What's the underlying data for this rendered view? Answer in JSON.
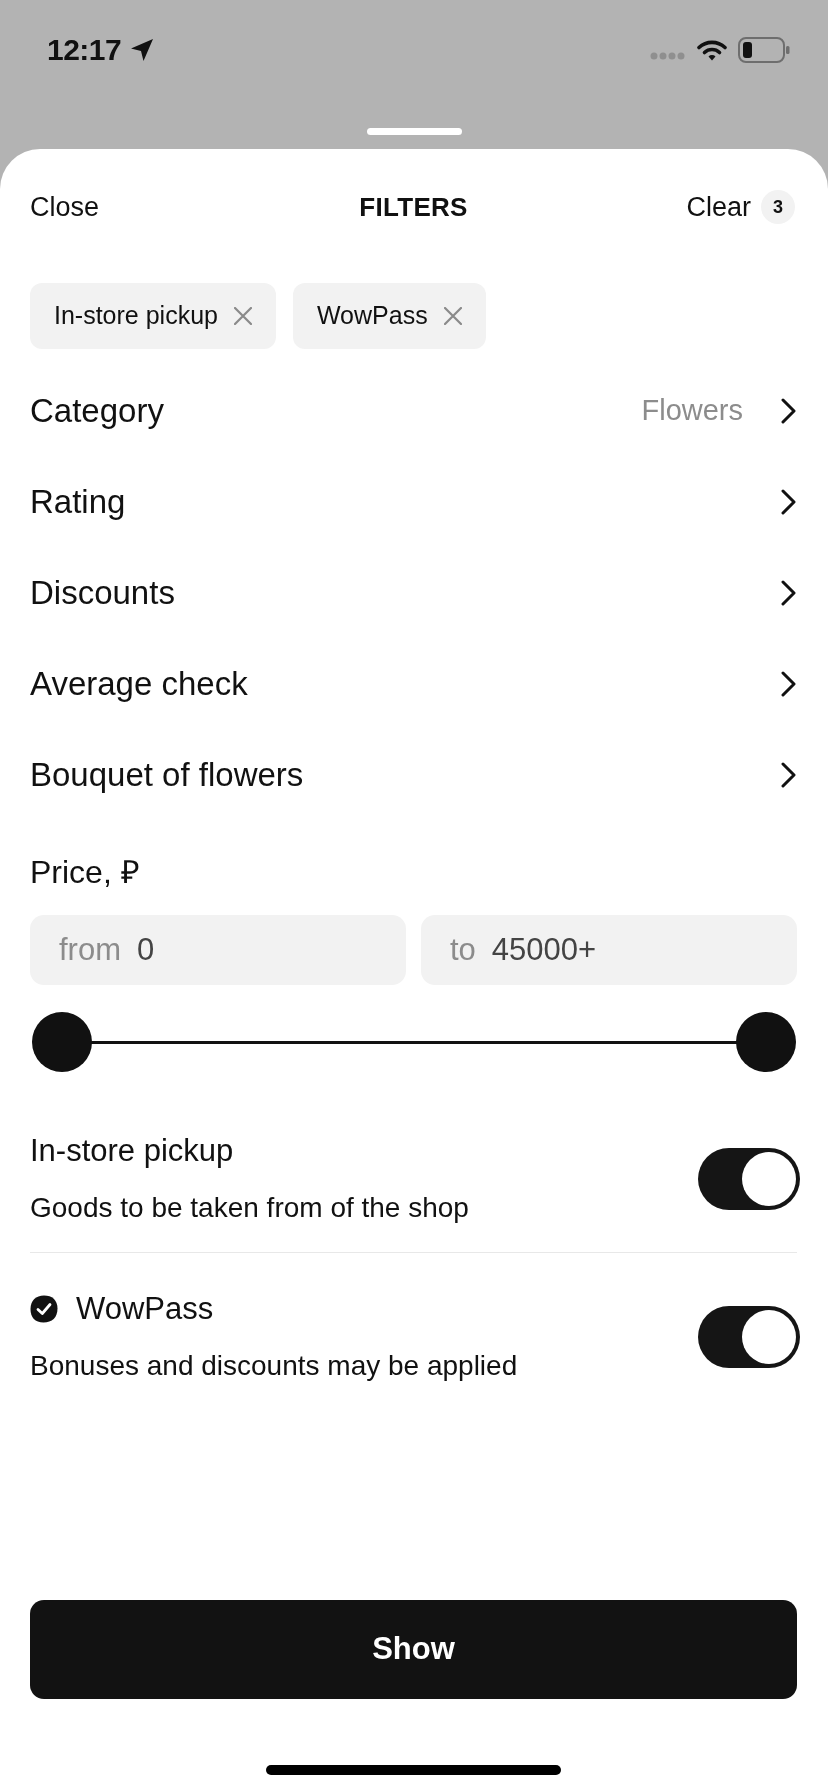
{
  "status_bar": {
    "time": "12:17"
  },
  "sheet": {
    "header": {
      "close": "Close",
      "title": "FILTERS",
      "clear": "Clear",
      "clear_count": "3"
    },
    "chips": [
      {
        "label": "In-store pickup"
      },
      {
        "label": "WowPass"
      }
    ],
    "options": [
      {
        "label": "Category",
        "value": "Flowers"
      },
      {
        "label": "Rating"
      },
      {
        "label": "Discounts"
      },
      {
        "label": "Average check"
      },
      {
        "label": "Bouquet of flowers"
      }
    ],
    "price": {
      "label": "Price, ₽",
      "fields": [
        {
          "prefix": "from",
          "value": "0"
        },
        {
          "prefix": "to",
          "value": "45000+"
        }
      ],
      "slider": {
        "thumbs": [
          {
            "level": 0
          },
          {
            "level": 1
          }
        ]
      }
    },
    "toggles": [
      {
        "kind": "plain",
        "title": "In-store pickup",
        "description": "Goods to be taken from of the shop",
        "on": true
      },
      {
        "kind": "verified",
        "title": "WowPass",
        "description": "Bonuses and discounts may be applied",
        "on": true
      }
    ],
    "show_button": "Show"
  }
}
